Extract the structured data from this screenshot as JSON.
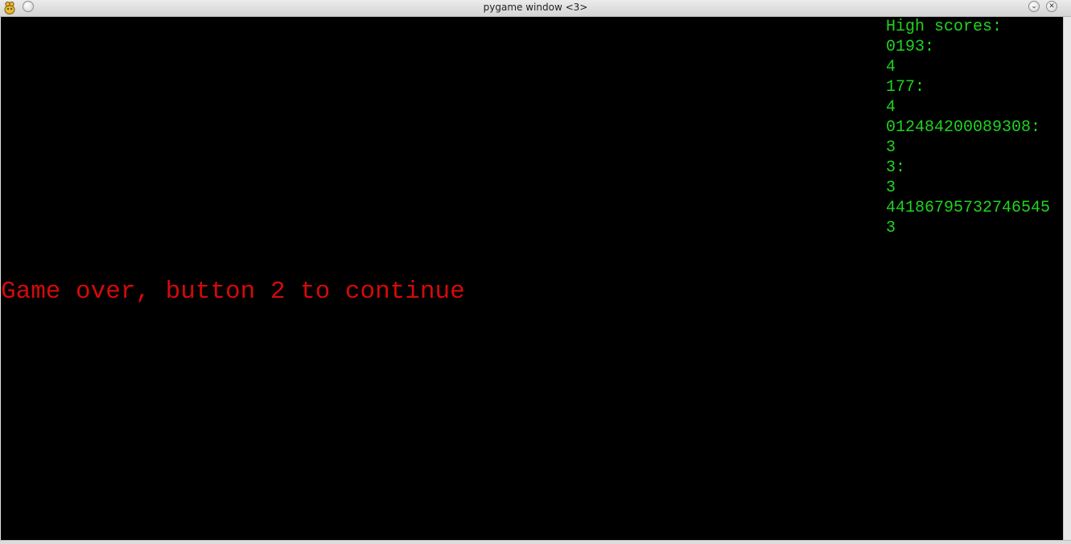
{
  "window": {
    "title": "pygame window <3>",
    "minimize_glyph": "⌄",
    "close_glyph": "✕"
  },
  "high_scores": {
    "heading": "High scores:",
    "entries": [
      {
        "name": "0193:",
        "score": "4"
      },
      {
        "name": "177:",
        "score": "4"
      },
      {
        "name": "012484200089308:",
        "score": "3"
      },
      {
        "name": "3:",
        "score": "3"
      },
      {
        "name": "44186795732746545",
        "score": "3"
      }
    ]
  },
  "message": {
    "text": "Game over, button 2 to continue"
  },
  "colors": {
    "score_text": "#1fd41f",
    "message_text": "#d40a0a",
    "background": "#000000"
  }
}
